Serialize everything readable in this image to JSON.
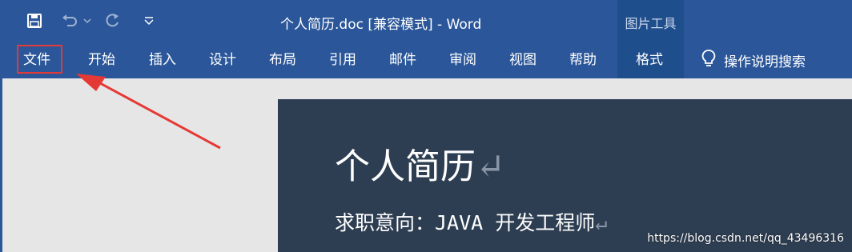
{
  "title_bar": {
    "document_title": "个人简历.doc [兼容模式]  -  Word",
    "context_group_label": "图片工具"
  },
  "quick_access": [
    {
      "icon": "save-icon"
    },
    {
      "icon": "undo-icon"
    },
    {
      "icon": "redo-icon"
    },
    {
      "icon": "customize-qat-icon"
    }
  ],
  "ribbon_tabs": [
    "文件",
    "开始",
    "插入",
    "设计",
    "布局",
    "引用",
    "邮件",
    "审阅",
    "视图",
    "帮助"
  ],
  "context_tab": "格式",
  "tell_me": {
    "label": "操作说明搜索",
    "icon": "lightbulb-icon"
  },
  "document": {
    "heading": "个人简历",
    "subheading": "求职意向：JAVA 开发工程师",
    "paragraph_mark": "↵"
  },
  "annotation": {
    "highlight_color": "#e53935",
    "points_to": "文件"
  },
  "watermark": "https://blog.csdn.net/qq_43496316",
  "colors": {
    "ribbon": "#2b579a",
    "context_group": "#1f4e8c",
    "page": "#2e3e52"
  }
}
